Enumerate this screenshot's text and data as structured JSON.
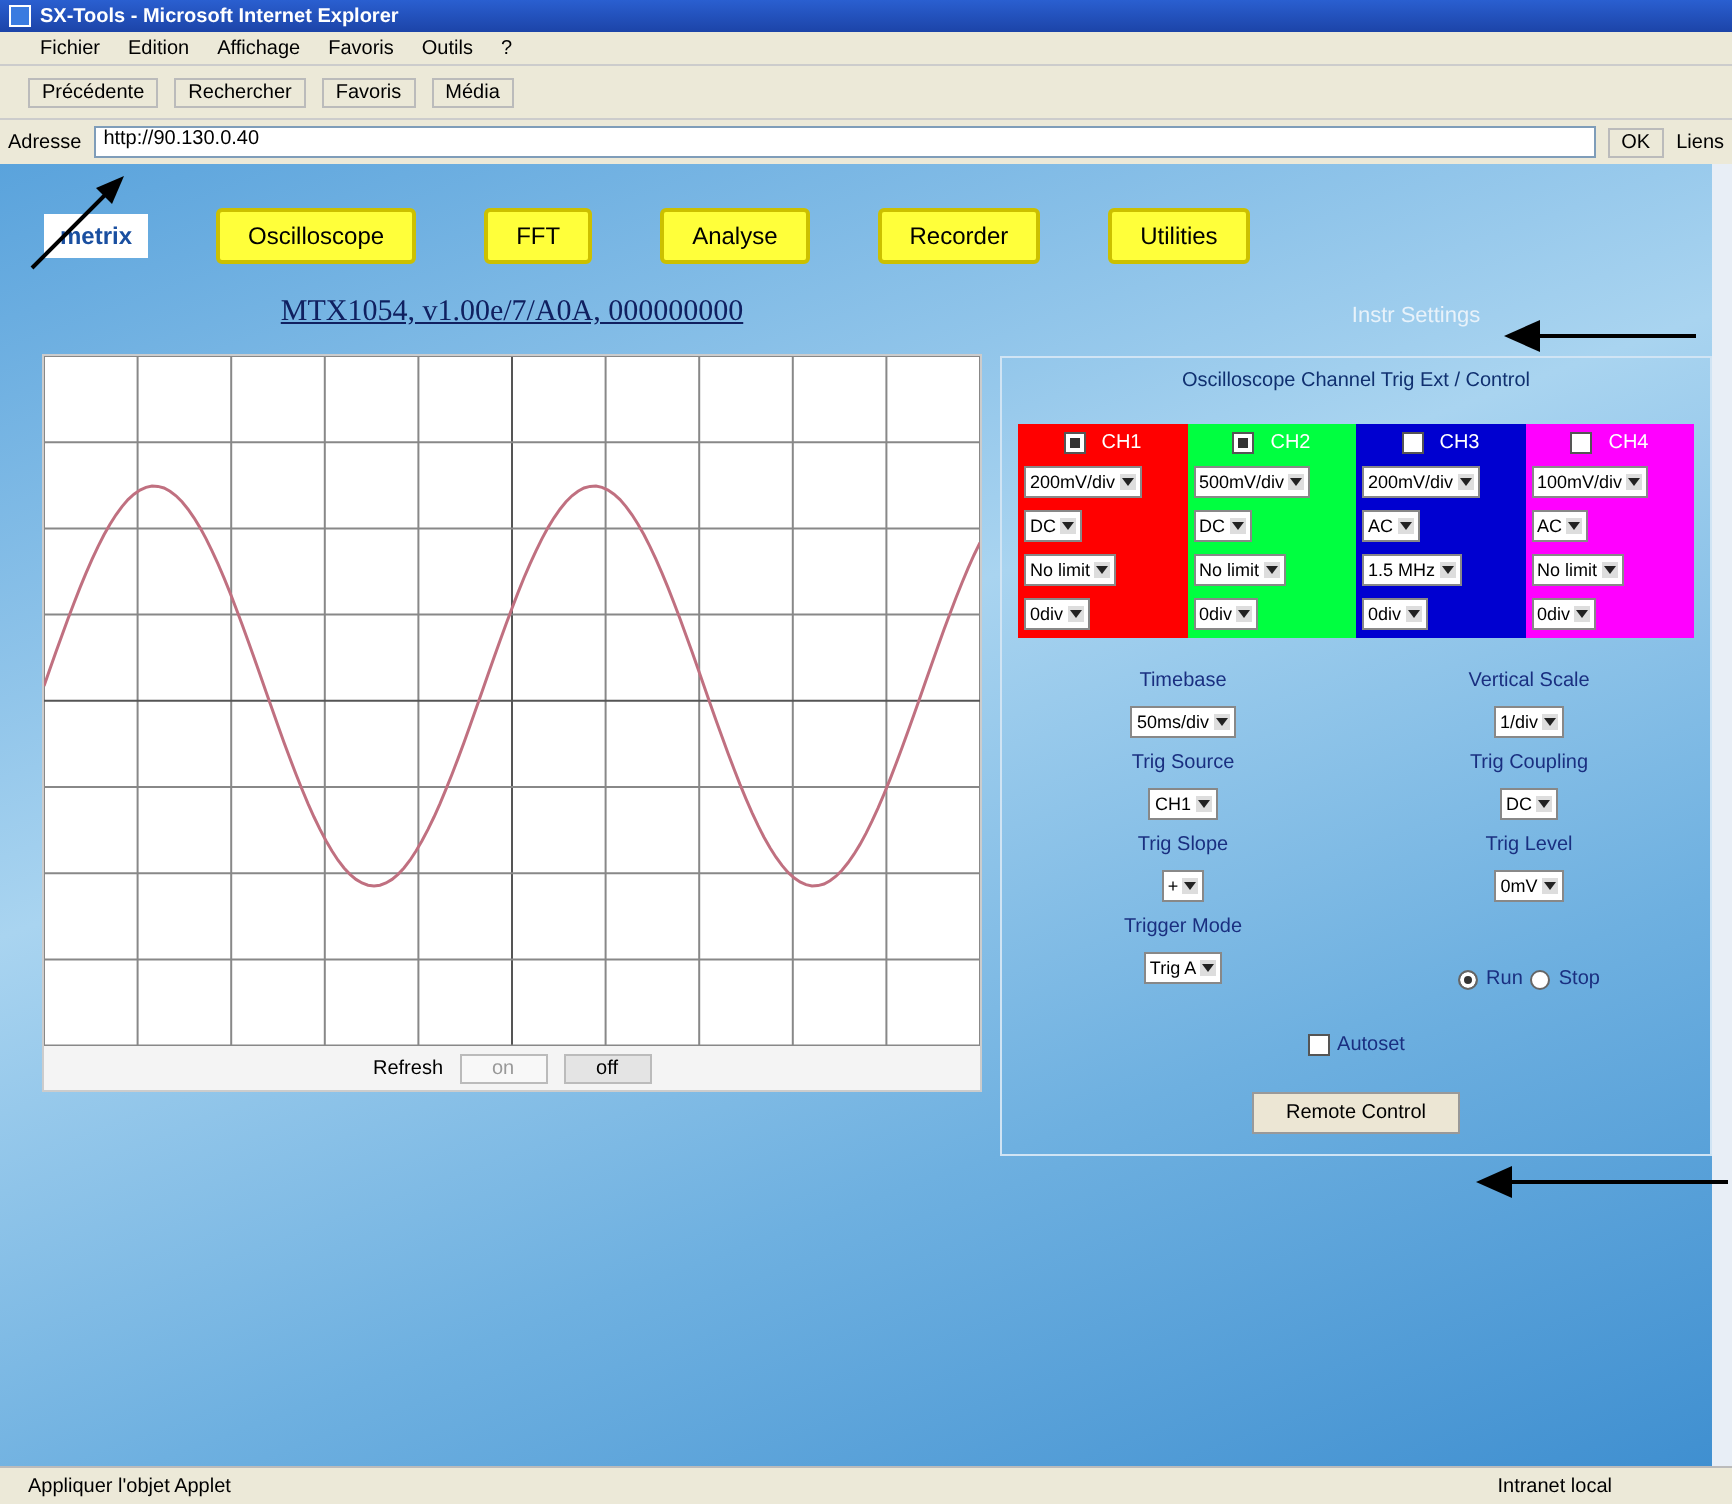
{
  "window": {
    "title": "SX-Tools - Microsoft Internet Explorer"
  },
  "menu": [
    "Fichier",
    "Edition",
    "Affichage",
    "Favoris",
    "Outils",
    "?"
  ],
  "toolbar": [
    {
      "label": "Précédente"
    },
    {
      "label": "Rechercher"
    },
    {
      "label": "Favoris"
    },
    {
      "label": "Média"
    }
  ],
  "address": {
    "label": "Adresse",
    "value": "http://90.130.0.40",
    "go": "OK",
    "links": "Liens"
  },
  "nav": {
    "logo": "metrix",
    "items": [
      {
        "label": "Oscilloscope"
      },
      {
        "label": "FFT"
      },
      {
        "label": "Analyse"
      },
      {
        "label": "Recorder"
      },
      {
        "label": "Utilities"
      }
    ]
  },
  "instrument_title": "MTX1054, v1.00e/7/A0A, 000000000",
  "status_text": "Instr Settings",
  "scope": {
    "refresh_label": "Refresh",
    "buttons": [
      {
        "label": "on",
        "selected": false
      },
      {
        "label": "off",
        "selected": true
      }
    ]
  },
  "panel": {
    "title": "Oscilloscope Channel Trig Ext / Control",
    "channels": [
      {
        "label": "CH1",
        "color": "#ff0000",
        "checked": true,
        "settings": [
          "200mV/div",
          "DC",
          "No limit",
          "0div"
        ]
      },
      {
        "label": "CH2",
        "color": "#00ff40",
        "checked": true,
        "settings": [
          "500mV/div",
          "DC",
          "No limit",
          "0div"
        ]
      },
      {
        "label": "CH3",
        "color": "#0000d0",
        "checked": false,
        "settings": [
          "200mV/div",
          "AC",
          "1.5 MHz",
          "0div"
        ]
      },
      {
        "label": "CH4",
        "color": "#ff00ff",
        "checked": false,
        "settings": [
          "100mV/div",
          "AC",
          "No limit",
          "0div"
        ]
      }
    ],
    "left": [
      {
        "label": "Timebase",
        "value": "50ms/div"
      },
      {
        "label": "Trig Source",
        "value": "CH1"
      },
      {
        "label": "Trig Slope",
        "value": "+"
      },
      {
        "label": "Trigger Mode",
        "value": "Trig A"
      }
    ],
    "right": [
      {
        "label": "Vertical Scale",
        "value": "1/div"
      },
      {
        "label": "Trig Coupling",
        "value": "DC"
      },
      {
        "label": "Trig Level",
        "value": "0mV"
      }
    ],
    "run_modes": [
      {
        "label": "Run",
        "selected": true
      },
      {
        "label": "Stop",
        "selected": false
      }
    ],
    "autoset": {
      "label": "Autoset",
      "checked": false
    },
    "button": "Remote Control"
  },
  "status_bar": {
    "left": "Appliquer l'objet Applet",
    "right": "Intranet local"
  }
}
